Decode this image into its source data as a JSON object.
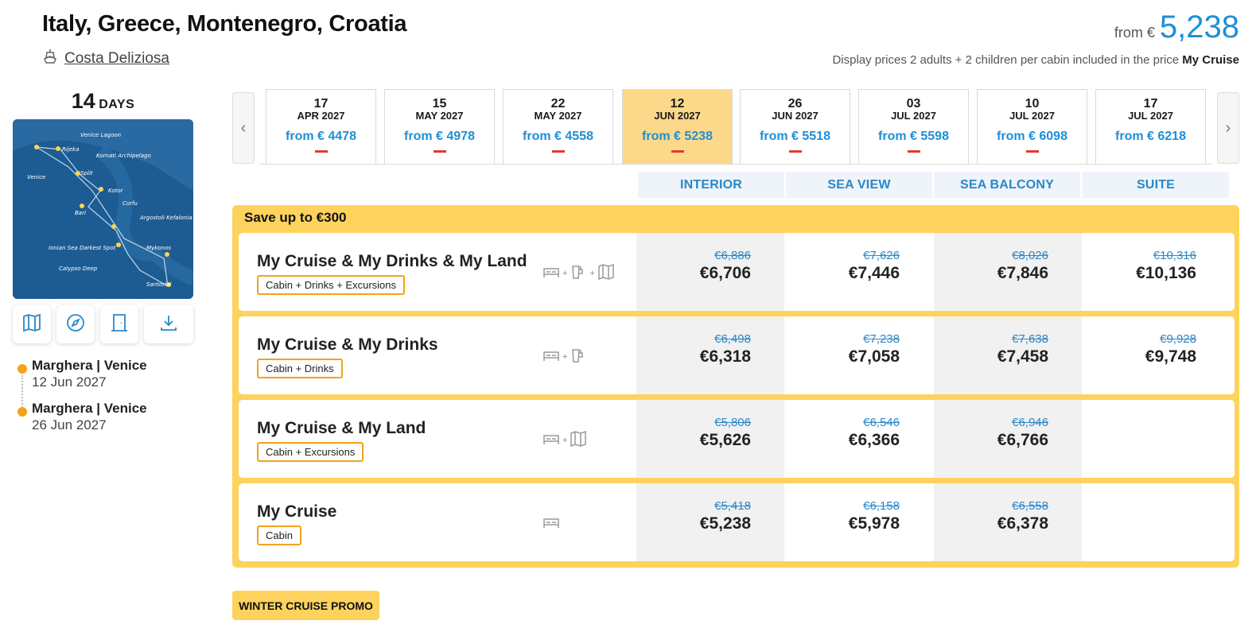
{
  "header": {
    "title": "Italy, Greece, Montenegro, Croatia",
    "ship_name": "Costa Deliziosa",
    "from_label": "from €",
    "from_price": "5,238",
    "display_note": "Display prices 2 adults + 2 children per cabin included in the price",
    "display_note_package": "My Cruise"
  },
  "itinerary": {
    "days_num": "14",
    "days_unit": "DAYS",
    "map_labels": [
      "Venice Lagoon",
      "Rijeka",
      "Kornati Archipelago",
      "Venice",
      "Split",
      "Kotor",
      "Corfu",
      "Bari",
      "Argostoli Kefalonia",
      "Ionian Sea Darkest Spot",
      "Mykonos",
      "Calypso Deep",
      "Santorini"
    ],
    "stops": [
      {
        "port": "Marghera | Venice",
        "date": "12 Jun 2027"
      },
      {
        "port": "Marghera | Venice",
        "date": "26 Jun 2027"
      }
    ]
  },
  "dates": [
    {
      "day": "17",
      "month": "APR 2027",
      "price": "from € 4478"
    },
    {
      "day": "15",
      "month": "MAY 2027",
      "price": "from € 4978"
    },
    {
      "day": "22",
      "month": "MAY 2027",
      "price": "from € 4558"
    },
    {
      "day": "12",
      "month": "JUN 2027",
      "price": "from € 5238"
    },
    {
      "day": "26",
      "month": "JUN 2027",
      "price": "from € 5518"
    },
    {
      "day": "03",
      "month": "JUL 2027",
      "price": "from € 5598"
    },
    {
      "day": "10",
      "month": "JUL 2027",
      "price": "from € 6098"
    },
    {
      "day": "17",
      "month": "JUL 2027",
      "price": "from € 6218"
    }
  ],
  "cabins": [
    "INTERIOR",
    "SEA VIEW",
    "SEA BALCONY",
    "SUITE"
  ],
  "promo": {
    "save_label": "Save up to €300",
    "packages": [
      {
        "name": "My Cruise & My Drinks & My Land",
        "tag": "Cabin + Drinks + Excursions",
        "icons": [
          "bed-icon",
          "drink-icon",
          "map-icon"
        ],
        "prices": [
          {
            "old": "€6,886",
            "new": "€6,706"
          },
          {
            "old": "€7,626",
            "new": "€7,446"
          },
          {
            "old": "€8,026",
            "new": "€7,846"
          },
          {
            "old": "€10,316",
            "new": "€10,136"
          }
        ]
      },
      {
        "name": "My Cruise & My Drinks",
        "tag": "Cabin + Drinks",
        "icons": [
          "bed-icon",
          "drink-icon"
        ],
        "prices": [
          {
            "old": "€6,498",
            "new": "€6,318"
          },
          {
            "old": "€7,238",
            "new": "€7,058"
          },
          {
            "old": "€7,638",
            "new": "€7,458"
          },
          {
            "old": "€9,928",
            "new": "€9,748"
          }
        ]
      },
      {
        "name": "My Cruise & My Land",
        "tag": "Cabin + Excursions",
        "icons": [
          "bed-icon",
          "map-icon"
        ],
        "prices": [
          {
            "old": "€5,806",
            "new": "€5,626"
          },
          {
            "old": "€6,546",
            "new": "€6,366"
          },
          {
            "old": "€6,946",
            "new": "€6,766"
          }
        ]
      },
      {
        "name": "My Cruise",
        "tag": "Cabin",
        "icons": [
          "bed-icon"
        ],
        "prices": [
          {
            "old": "€5,418",
            "new": "€5,238"
          },
          {
            "old": "€6,158",
            "new": "€5,978"
          },
          {
            "old": "€6,558",
            "new": "€6,378"
          }
        ]
      }
    ]
  },
  "winter_promo_label": "WINTER CRUISE PROMO",
  "colors": {
    "accent_blue": "#1e8fd6",
    "promo_yellow": "#fdd35e",
    "active_date": "#fcd98a",
    "tag_border": "#f2a31b",
    "price_bar_red": "#e23a2e"
  }
}
